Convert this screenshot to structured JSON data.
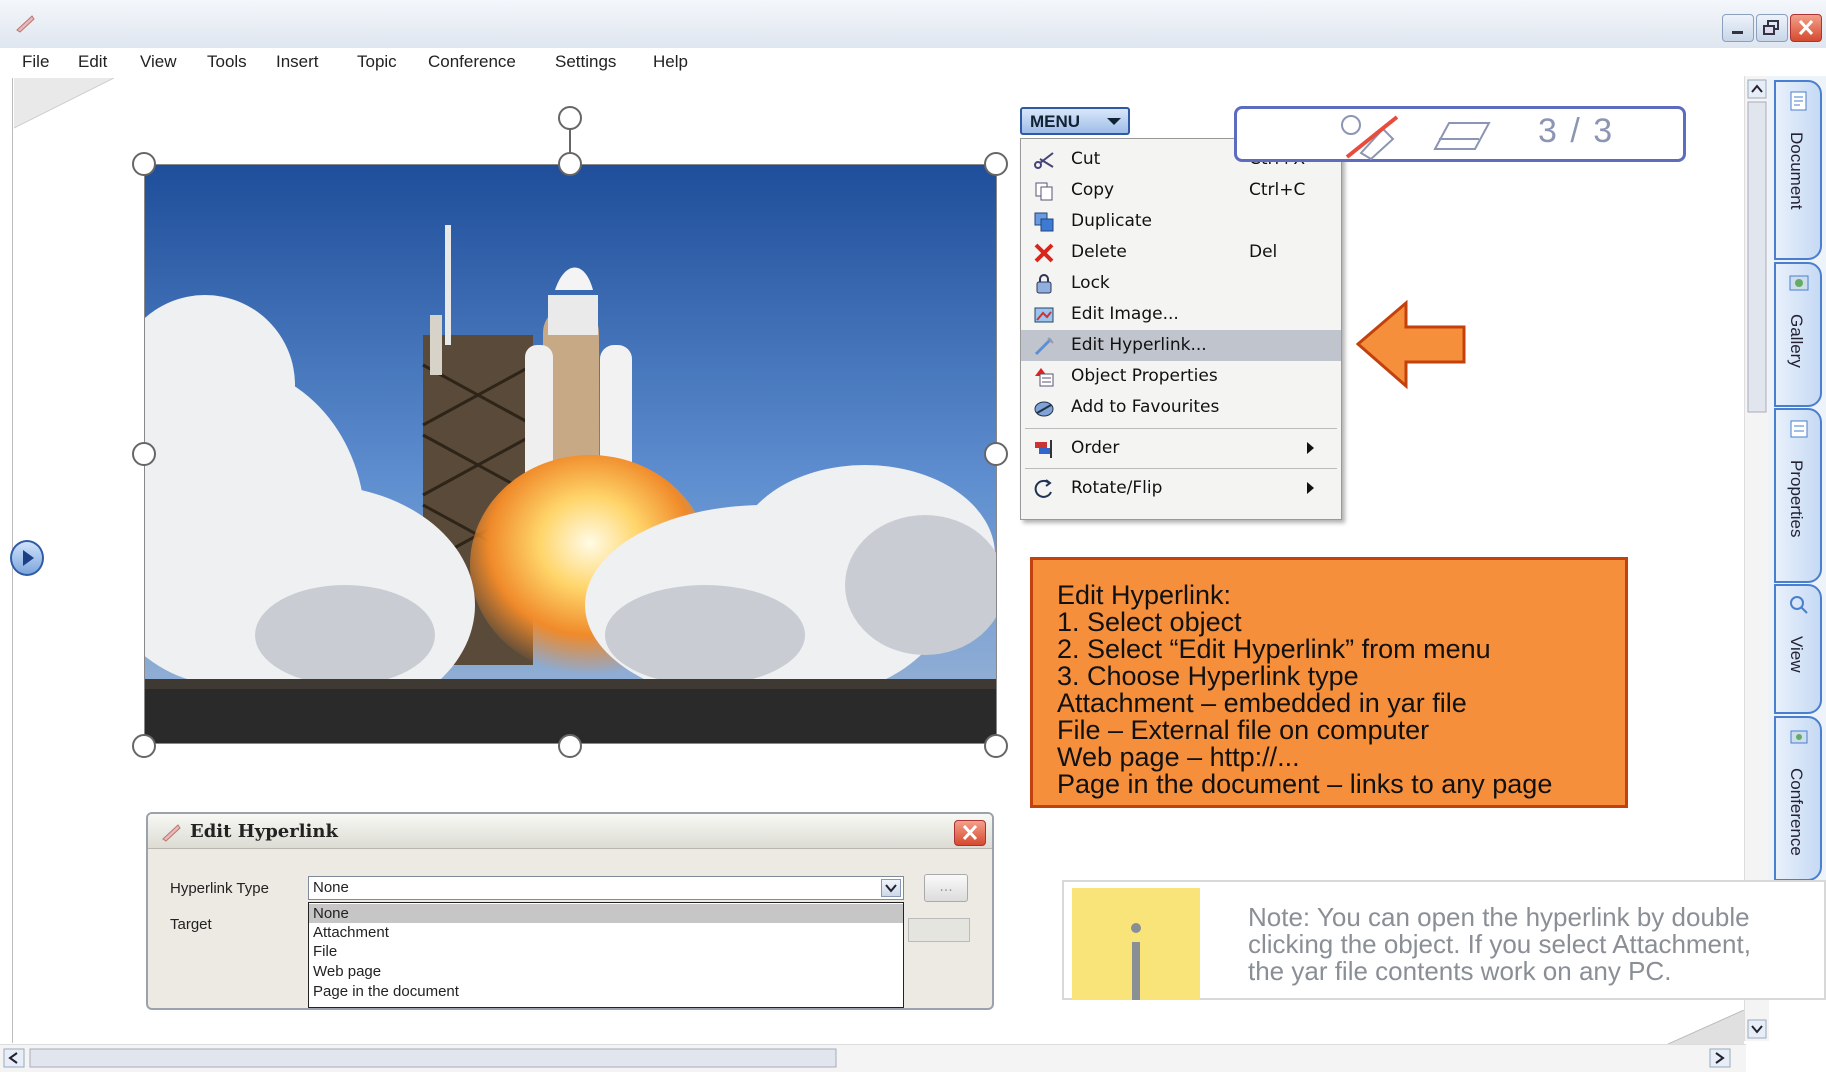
{
  "menubar": {
    "items": [
      "File",
      "Edit",
      "View",
      "Tools",
      "Insert",
      "Topic",
      "Conference",
      "Settings",
      "Help"
    ]
  },
  "window_controls": [
    "minimize",
    "restore",
    "close"
  ],
  "context_menu": {
    "button_label": "MENU",
    "items": [
      {
        "label": "Cut",
        "shortcut": "Ctrl+X",
        "icon": "scissors-icon"
      },
      {
        "label": "Copy",
        "shortcut": "Ctrl+C",
        "icon": "copy-icon"
      },
      {
        "label": "Duplicate",
        "shortcut": "",
        "icon": "duplicate-icon"
      },
      {
        "label": "Delete",
        "shortcut": "Del",
        "icon": "delete-x-icon"
      },
      {
        "label": "Lock",
        "shortcut": "",
        "icon": "lock-icon"
      },
      {
        "label": "Edit Image...",
        "shortcut": "",
        "icon": "edit-image-icon"
      },
      {
        "label": "Edit Hyperlink...",
        "shortcut": "",
        "icon": "hyperlink-icon",
        "selected": true
      },
      {
        "label": "Object Properties",
        "shortcut": "",
        "icon": "properties-icon"
      },
      {
        "label": "Add to Favourites",
        "shortcut": "",
        "icon": "favourites-icon"
      },
      {
        "label": "Order",
        "shortcut": "",
        "icon": "order-icon",
        "submenu": true
      },
      {
        "label": "Rotate/Flip",
        "shortcut": "",
        "icon": "rotate-icon",
        "submenu": true
      }
    ]
  },
  "toolbar": {
    "page_counter": "3 / 3"
  },
  "side_tabs": [
    "Document",
    "Gallery",
    "Properties",
    "View",
    "Conference"
  ],
  "callout": {
    "lines": [
      "Edit Hyperlink:",
      "1.    Select object",
      "2.    Select “Edit Hyperlink” from menu",
      "3.    Choose Hyperlink type",
      "Attachment – embedded in yar file",
      "File – External file on computer",
      "Web page – http://...",
      "Page in the document – links to any page"
    ],
    "bg_color": "#f58f3c"
  },
  "dialog": {
    "title": "Edit Hyperlink",
    "type_label": "Hyperlink Type",
    "type_value": "None",
    "target_label": "Target",
    "browse_label": "...",
    "options": [
      "None",
      "Attachment",
      "File",
      "Web page",
      "Page in the document"
    ]
  },
  "note": {
    "icon_letter": "i",
    "lines": [
      "Note: You can open the hyperlink by double",
      "clicking the object. If you select Attachment,",
      "the yar file contents work on any PC."
    ]
  }
}
